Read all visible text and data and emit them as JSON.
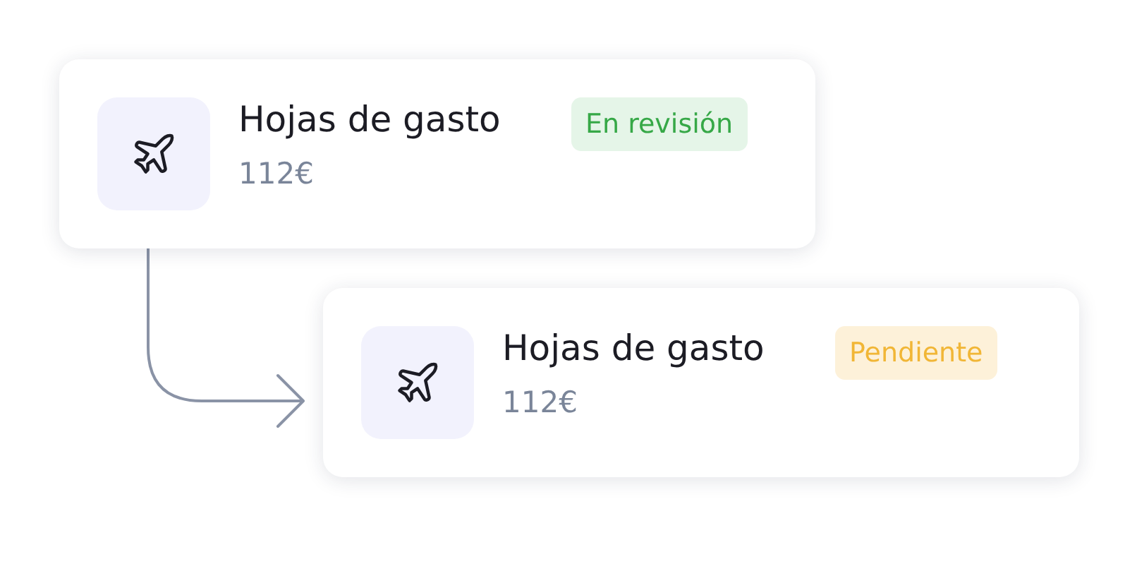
{
  "cards": [
    {
      "title": "Hojas de gasto",
      "amount": "112€",
      "status": {
        "label": "En revisión",
        "kind": "review"
      }
    },
    {
      "title": "Hojas de gasto",
      "amount": "112€",
      "status": {
        "label": "Pendiente",
        "kind": "pending"
      }
    }
  ]
}
